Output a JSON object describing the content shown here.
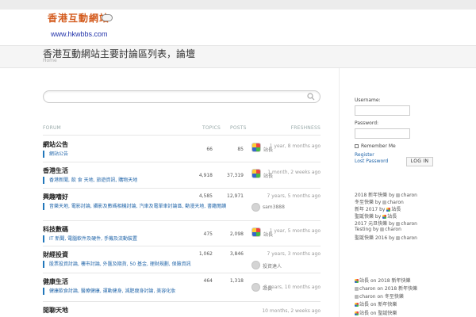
{
  "header": {
    "logo_cn": "香港互動網站",
    "logo_url": "www.hkwbbs.com",
    "page_title": "香港互動網站主要討論區列表，論壇",
    "breadcrumb": "Home"
  },
  "search": {
    "placeholder": ""
  },
  "table": {
    "headers": {
      "forum": "FORUM",
      "topics": "TOPICS",
      "posts": "POSTS",
      "freshness": "FRESHNESS"
    },
    "rows": [
      {
        "name": "網站公告",
        "subs": "網站公告",
        "topics": "66",
        "posts": "85",
        "freshness": "1 year, 8 months ago",
        "author": "站長",
        "avatar": "color"
      },
      {
        "name": "香港生活",
        "subs": "香港新聞, 飲 食 天地, 旅遊資訊, 購物天地",
        "topics": "4,918",
        "posts": "37,319",
        "freshness": "1 month, 2 weeks ago",
        "author": "站長",
        "avatar": "color"
      },
      {
        "name": "興趣嗜好",
        "subs": "音樂天地, 電影討論, 攝影及數碼相機討論, 汽車及電單車討論區, 動漫天地, 書籍閱讀",
        "topics": "4,585",
        "posts": "12,971",
        "freshness": "7 years, 5 months ago",
        "author": "sam3888",
        "avatar": "gray"
      },
      {
        "name": "科技數碼",
        "subs": "IT 新聞, 電腦軟件及硬件, 手機及流動裝置",
        "topics": "475",
        "posts": "2,098",
        "freshness": "1 year, 5 months ago",
        "author": "站長",
        "avatar": "color"
      },
      {
        "name": "財經投資",
        "subs": "股票投資討論, 樓市討論, 外匯及期貨, 50 基金, 理財規劃, 保險資訊",
        "topics": "1,062",
        "posts": "3,846",
        "freshness": "7 years, 3 months ago",
        "author": "投資達人",
        "avatar": "gray"
      },
      {
        "name": "健康生活",
        "subs": "健康飲食討論, 醫療健康, 運動健身, 減肥瘦身討論, 美容化妝",
        "topics": "464",
        "posts": "1,318",
        "freshness": "8 years, 10 months ago",
        "author": "站長",
        "avatar": "gray"
      },
      {
        "name": "閒聊天地",
        "subs": "",
        "topics": "",
        "posts": "",
        "freshness": "10 months, 2 weeks ago",
        "author": "",
        "avatar": "none"
      }
    ]
  },
  "login": {
    "username_label": "Username:",
    "password_label": "Password:",
    "remember_label": "Remember Me",
    "register_link": "Register",
    "lost_password_link": "Lost Password",
    "login_button": "LOG IN"
  },
  "recent_topics": [
    {
      "text": "2018 新年快樂 by",
      "user": "charon",
      "icon": "gray"
    },
    {
      "text": "冬至快樂 by",
      "user": "charon",
      "icon": "gray"
    },
    {
      "text": "新年 2017 by",
      "user": "站長",
      "icon": "color"
    },
    {
      "text": "聖誕快樂 by",
      "user": "站長",
      "icon": "color"
    },
    {
      "text": "2017 元旦快樂 by",
      "user": "charon",
      "icon": "gray"
    },
    {
      "text": "Testing by",
      "user": "charon",
      "icon": "gray"
    },
    {
      "text": "聖誕快樂 2016 by",
      "user": "charon",
      "icon": "gray"
    }
  ],
  "recent_replies": [
    {
      "user": "站長",
      "text": "on 2018 新年快樂",
      "icon": "color"
    },
    {
      "user": "charon",
      "text": "on 2018 新年快樂",
      "icon": "gray"
    },
    {
      "user": "charon",
      "text": "on 冬至快樂",
      "icon": "gray"
    },
    {
      "user": "站長",
      "text": "on 新年快樂",
      "icon": "color"
    },
    {
      "user": "站長",
      "text": "on 聖誕快樂",
      "icon": "color"
    }
  ]
}
